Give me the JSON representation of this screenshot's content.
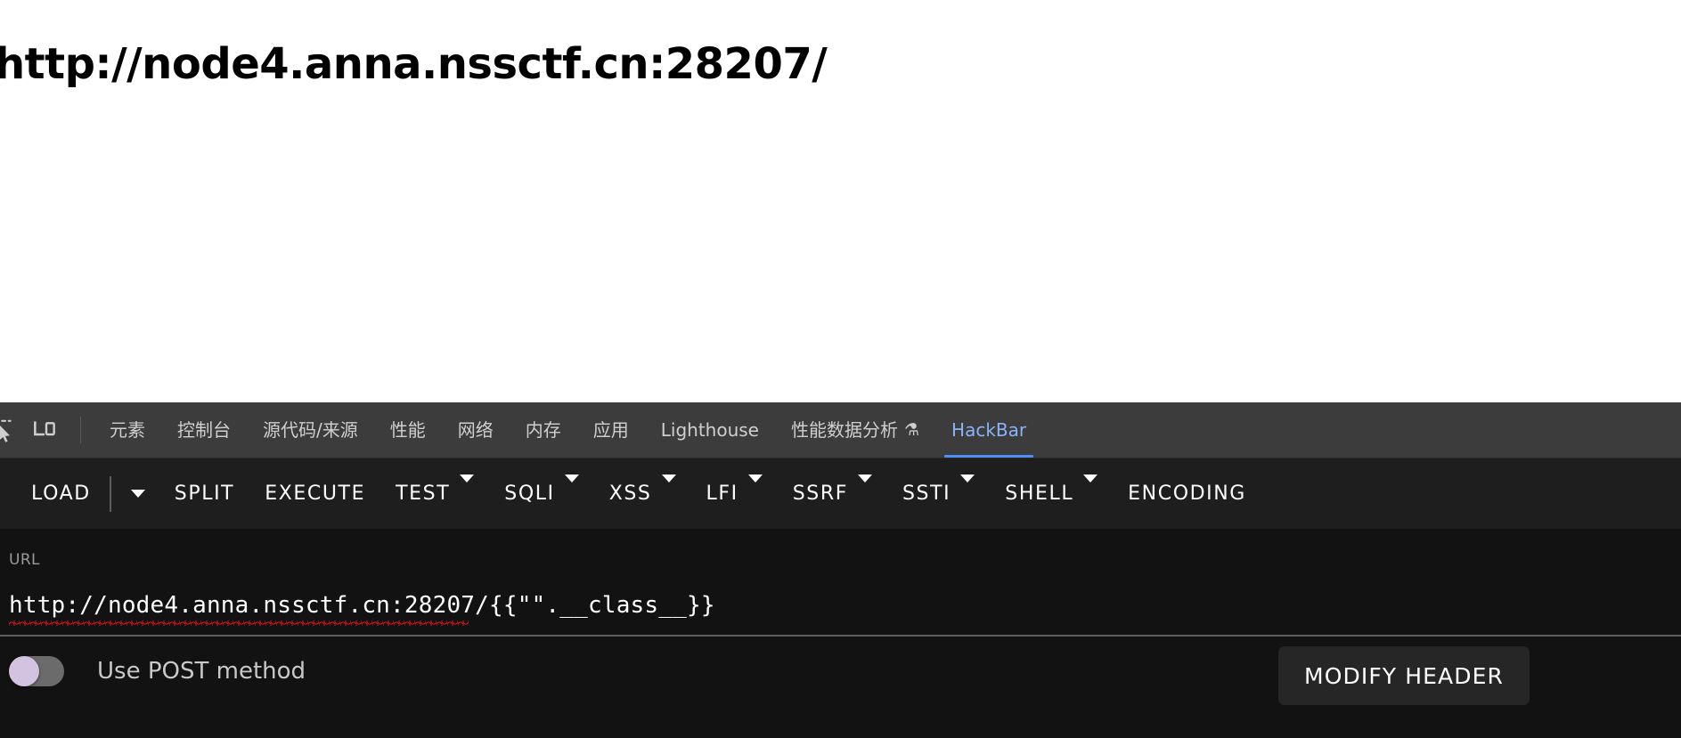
{
  "page": {
    "heading": "http://node4.anna.nssctf.cn:28207/"
  },
  "devtools": {
    "icons": [
      {
        "name": "inspect-element-icon",
        "label": "Inspect element"
      },
      {
        "name": "device-toolbar-icon",
        "label": "Toggle device toolbar"
      }
    ],
    "tabs": [
      {
        "label": "元素",
        "active": false
      },
      {
        "label": "控制台",
        "active": false
      },
      {
        "label": "源代码/来源",
        "active": false
      },
      {
        "label": "性能",
        "active": false
      },
      {
        "label": "网络",
        "active": false
      },
      {
        "label": "内存",
        "active": false
      },
      {
        "label": "应用",
        "active": false
      },
      {
        "label": "Lighthouse",
        "active": false
      },
      {
        "label": "性能数据分析",
        "active": false,
        "badge": "⚗"
      },
      {
        "label": "HackBar",
        "active": true
      }
    ],
    "active_tab": "HackBar",
    "colors": {
      "tabbar_bg": "#3c3c3c",
      "active_tab_text": "#8ab4f8",
      "active_tab_underline": "#4f8df6",
      "toolbar_bg": "#1e1e1e",
      "body_bg": "#121212",
      "spellcheck_red": "#ea1717",
      "toggle_knob": "#d2c3e0"
    }
  },
  "hackbar": {
    "toolbar": [
      {
        "label": "LOAD",
        "caret": false
      },
      {
        "label": "",
        "caret": true,
        "caret_only": true
      },
      {
        "label": "SPLIT",
        "caret": false
      },
      {
        "label": "EXECUTE",
        "caret": false
      },
      {
        "label": "TEST",
        "caret": true
      },
      {
        "label": "SQLI",
        "caret": true
      },
      {
        "label": "XSS",
        "caret": true
      },
      {
        "label": "LFI",
        "caret": true
      },
      {
        "label": "SSRF",
        "caret": true
      },
      {
        "label": "SSTI",
        "caret": true
      },
      {
        "label": "SHELL",
        "caret": true
      },
      {
        "label": "ENCODING",
        "caret": false
      }
    ],
    "url": {
      "label": "URL",
      "value": "http://node4.anna.nssctf.cn:28207/{{\"\".__class__}}",
      "placeholder": "URL",
      "spellcheck_underline": true
    },
    "post_toggle": {
      "label": "Use POST method",
      "checked": false
    },
    "modify_header_label": "MODIFY HEADER"
  }
}
